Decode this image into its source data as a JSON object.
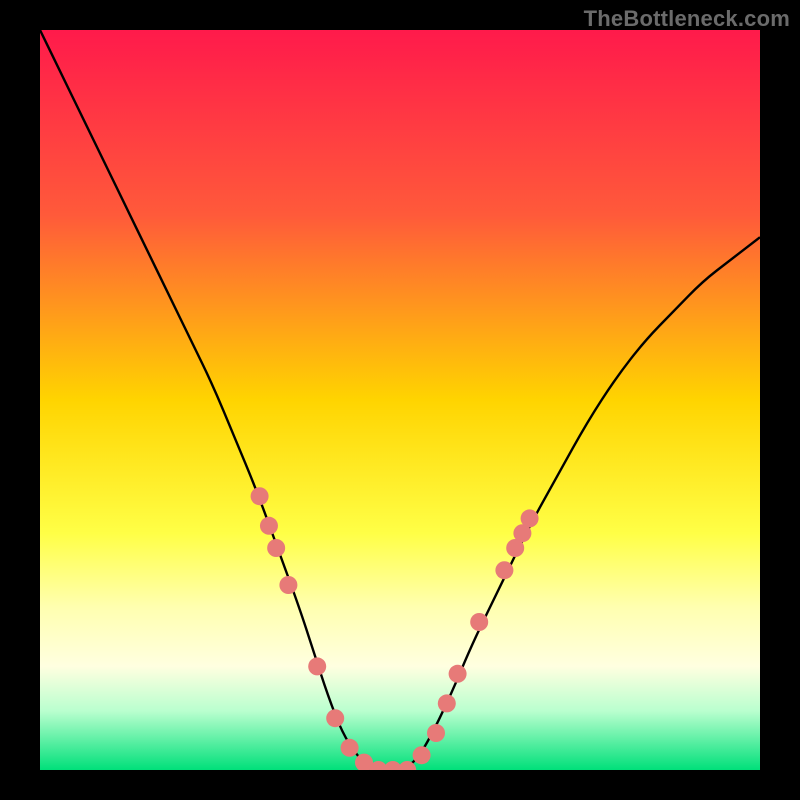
{
  "watermark": "TheBottleneck.com",
  "chart_data": {
    "type": "line",
    "title": "",
    "xlabel": "",
    "ylabel": "",
    "xlim": [
      0,
      100
    ],
    "ylim": [
      0,
      100
    ],
    "background": {
      "type": "vertical-gradient",
      "stops": [
        {
          "y": 0,
          "color": "#ff1a4b"
        },
        {
          "y": 25,
          "color": "#ff5a3a"
        },
        {
          "y": 50,
          "color": "#ffd400"
        },
        {
          "y": 68,
          "color": "#ffff46"
        },
        {
          "y": 78,
          "color": "#ffffb0"
        },
        {
          "y": 86,
          "color": "#ffffe0"
        },
        {
          "y": 92,
          "color": "#baffcf"
        },
        {
          "y": 100,
          "color": "#00e07a"
        }
      ]
    },
    "series": [
      {
        "name": "bottleneck-curve",
        "color": "#000000",
        "x": [
          0,
          3,
          6,
          9,
          12,
          15,
          18,
          21,
          24,
          27,
          30,
          33,
          36,
          38,
          40,
          42,
          44,
          46,
          48,
          50,
          52,
          54,
          57,
          60,
          64,
          68,
          72,
          76,
          80,
          84,
          88,
          92,
          96,
          100
        ],
        "y": [
          100,
          94,
          88,
          82,
          76,
          70,
          64,
          58,
          52,
          45,
          38,
          30,
          22,
          16,
          10,
          5,
          2,
          0,
          0,
          0,
          1,
          4,
          10,
          17,
          25,
          33,
          40,
          47,
          53,
          58,
          62,
          66,
          69,
          72
        ]
      }
    ],
    "markers": {
      "name": "highlight-dots",
      "color": "#e77a78",
      "radius": 9,
      "points": [
        {
          "x": 30.5,
          "y": 37
        },
        {
          "x": 31.8,
          "y": 33
        },
        {
          "x": 32.8,
          "y": 30
        },
        {
          "x": 34.5,
          "y": 25
        },
        {
          "x": 38.5,
          "y": 14
        },
        {
          "x": 41.0,
          "y": 7
        },
        {
          "x": 43.0,
          "y": 3
        },
        {
          "x": 45.0,
          "y": 1
        },
        {
          "x": 47.0,
          "y": 0
        },
        {
          "x": 49.0,
          "y": 0
        },
        {
          "x": 51.0,
          "y": 0
        },
        {
          "x": 53.0,
          "y": 2
        },
        {
          "x": 55.0,
          "y": 5
        },
        {
          "x": 56.5,
          "y": 9
        },
        {
          "x": 58.0,
          "y": 13
        },
        {
          "x": 61.0,
          "y": 20
        },
        {
          "x": 64.5,
          "y": 27
        },
        {
          "x": 66.0,
          "y": 30
        },
        {
          "x": 67.0,
          "y": 32
        },
        {
          "x": 68.0,
          "y": 34
        }
      ]
    }
  }
}
